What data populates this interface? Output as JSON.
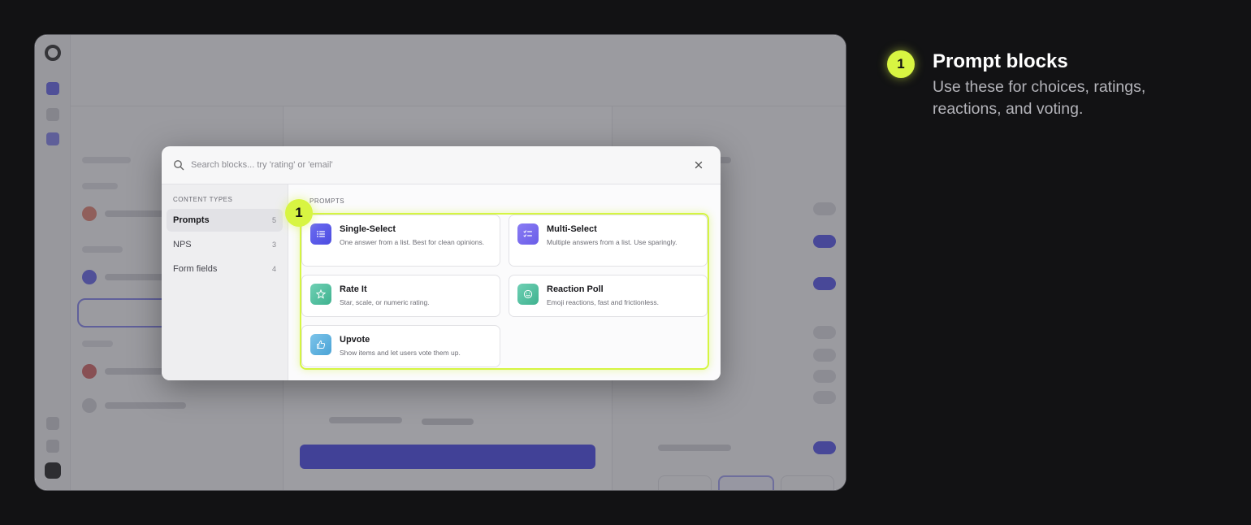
{
  "modal": {
    "search_placeholder": "Search blocks... try 'rating' or 'email'",
    "sidebar_heading": "CONTENT TYPES",
    "categories": [
      {
        "label": "Prompts",
        "count": "5"
      },
      {
        "label": "NPS",
        "count": "3"
      },
      {
        "label": "Form fields",
        "count": "4"
      }
    ],
    "section_heading": "PROMPTS",
    "blocks": [
      {
        "title": "Single-Select",
        "desc": "One answer from a list. Best for clean opinions.",
        "icon": "list-icon"
      },
      {
        "title": "Multi-Select",
        "desc": "Multiple answers from a list. Use sparingly.",
        "icon": "checklist-icon"
      },
      {
        "title": "Rate It",
        "desc": "Star, scale, or numeric rating.",
        "icon": "star-icon"
      },
      {
        "title": "Reaction Poll",
        "desc": "Emoji reactions, fast and frictionless.",
        "icon": "smiley-icon"
      },
      {
        "title": "Upvote",
        "desc": "Show items and let users vote them up.",
        "icon": "thumbs-up-icon"
      }
    ]
  },
  "marker": {
    "label": "1"
  },
  "annotation": {
    "number": "1",
    "title": "Prompt blocks",
    "description": "Use these for choices, ratings, reactions, and voting."
  },
  "colors": {
    "accent": "#d8f542",
    "background": "#121214",
    "primary": "#4d4de0"
  }
}
